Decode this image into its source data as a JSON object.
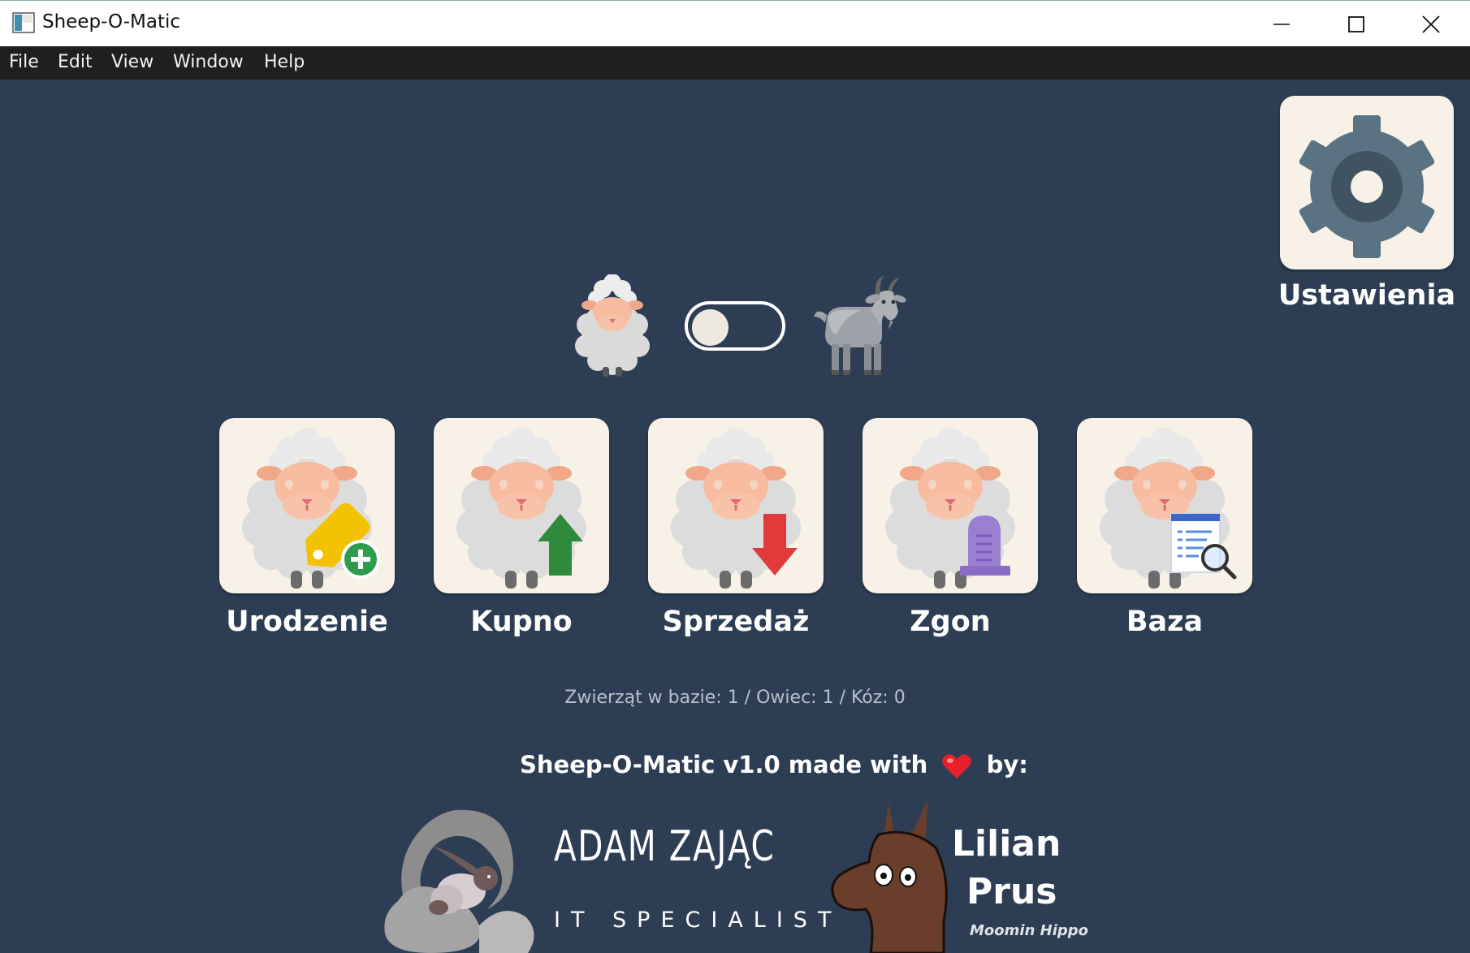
{
  "window": {
    "title": "Sheep-O-Matic",
    "controls": [
      "minimize-icon",
      "maximize-icon",
      "close-icon"
    ]
  },
  "menu": [
    "File",
    "Edit",
    "View",
    "Window",
    "Help"
  ],
  "settings": {
    "label": "Ustawienia",
    "icon": "gear-icon"
  },
  "animal_toggle": {
    "left_icon": "sheep-icon",
    "right_icon": "goat-icon",
    "state": "off"
  },
  "actions": [
    {
      "label": "Urodzenie",
      "icon": "sheep-birth-icon"
    },
    {
      "label": "Kupno",
      "icon": "sheep-buy-icon"
    },
    {
      "label": "Sprzedaż",
      "icon": "sheep-sell-icon"
    },
    {
      "label": "Zgon",
      "icon": "sheep-death-icon"
    },
    {
      "label": "Baza",
      "icon": "sheep-database-icon"
    }
  ],
  "stats": "Zwierząt w bazie: 1 / Owiec: 1 / Kóz: 0",
  "footer": {
    "made_with_prefix": "Sheep-O-Matic v1.0 made with",
    "made_with_suffix": "by:",
    "author1": {
      "name": "ADAM ZAJĄC",
      "role": "IT SPECIALIST"
    },
    "author2": {
      "first": "Lilian",
      "last": "Prus",
      "tagline": "Moomin Hippo"
    }
  },
  "colors": {
    "background": "#2d3e54",
    "tile": "#f7f1e7",
    "menubar": "#1f1f1f",
    "gear": "#5a7383"
  }
}
